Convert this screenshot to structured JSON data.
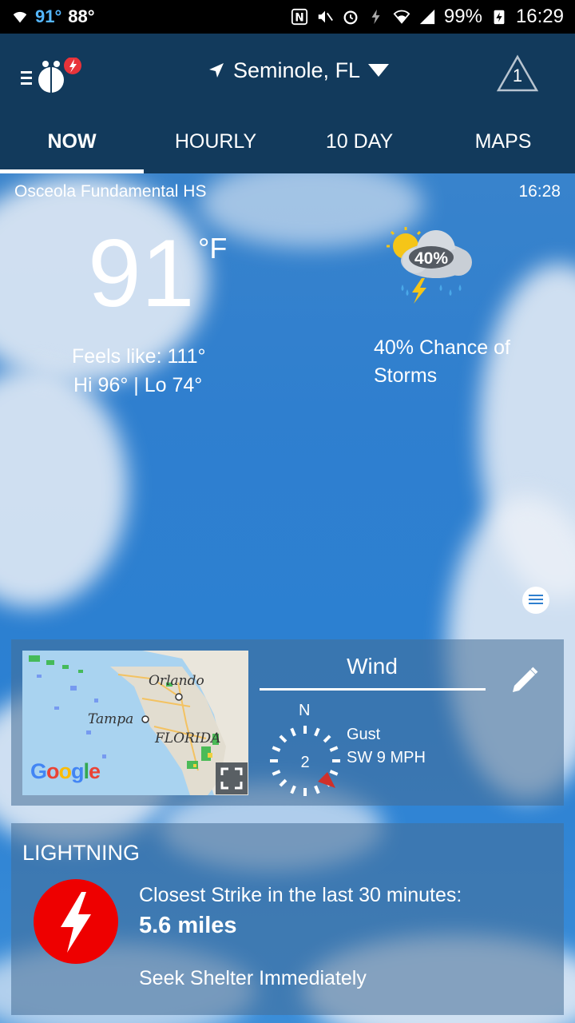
{
  "status_bar": {
    "temp_current": "91°",
    "temp_other": "88°",
    "battery": "99%",
    "time": "16:29"
  },
  "header": {
    "location": "Seminole, FL",
    "alert_count": "1",
    "tabs": [
      {
        "label": "NOW",
        "active": true
      },
      {
        "label": "HOURLY",
        "active": false
      },
      {
        "label": "10 DAY",
        "active": false
      },
      {
        "label": "MAPS",
        "active": false
      }
    ]
  },
  "current": {
    "station": "Osceola Fundamental HS",
    "observed_time": "16:28",
    "temperature": "91",
    "unit": "°F",
    "feels_like": "Feels like: 111°",
    "hi_lo": "Hi 96° | Lo 74°",
    "condition_icon": "thunderstorm-partly-sunny-icon",
    "condition_percent": "40%",
    "condition_text": "40% Chance of Storms"
  },
  "map_card": {
    "labels": {
      "orlando": "Orlando",
      "tampa": "Tampa",
      "florida": "FLORIDA"
    },
    "google": "Google"
  },
  "wind": {
    "title": "Wind",
    "compass_north": "N",
    "speed": "2",
    "gust_label": "Gust",
    "gust_value": "SW 9 MPH"
  },
  "lightning": {
    "title": "LIGHTNING",
    "label": "Closest Strike in the last 30 minutes:",
    "distance": "5.6 miles",
    "advice": "Seek Shelter Immediately"
  },
  "colors": {
    "header_bg": "#123a5c",
    "lightning_red": "#e00000",
    "google_blue": "#4285f4",
    "google_red": "#ea4335",
    "google_yellow": "#fbbc05",
    "google_green": "#34a853"
  }
}
